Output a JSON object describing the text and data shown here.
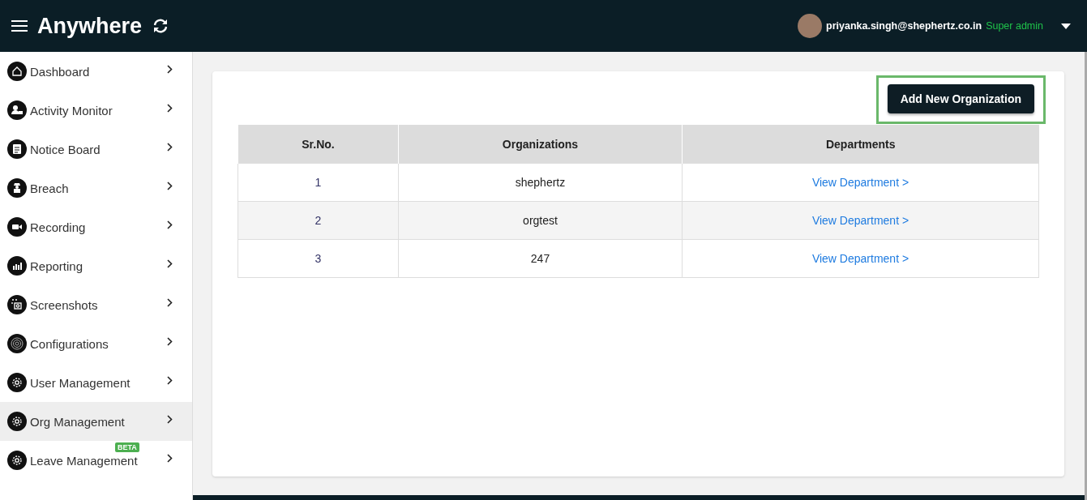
{
  "header": {
    "logo": "Anywhere",
    "user": {
      "email": "priyanka.singh@shephertz.co.in",
      "role": "Super admin"
    }
  },
  "sidebar": {
    "items": [
      {
        "label": "Dashboard",
        "selected": false
      },
      {
        "label": "Activity Monitor",
        "selected": false
      },
      {
        "label": "Notice Board",
        "selected": false
      },
      {
        "label": "Breach",
        "selected": false
      },
      {
        "label": "Recording",
        "selected": false
      },
      {
        "label": "Reporting",
        "selected": false
      },
      {
        "label": "Screenshots",
        "selected": false
      },
      {
        "label": "Configurations",
        "selected": false
      },
      {
        "label": "User Management",
        "selected": false
      },
      {
        "label": "Org Management",
        "selected": true
      },
      {
        "label": "Leave Management",
        "selected": false,
        "badge": "BETA"
      }
    ]
  },
  "main": {
    "add_button": "Add New Organization",
    "table": {
      "columns": [
        "Sr.No.",
        "Organizations",
        "Departments"
      ],
      "rows": [
        {
          "sr": "1",
          "organization": "shephertz",
          "link": "View Department >"
        },
        {
          "sr": "2",
          "organization": "orgtest",
          "link": "View Department >"
        },
        {
          "sr": "3",
          "organization": "247",
          "link": "View Department >"
        }
      ]
    }
  }
}
